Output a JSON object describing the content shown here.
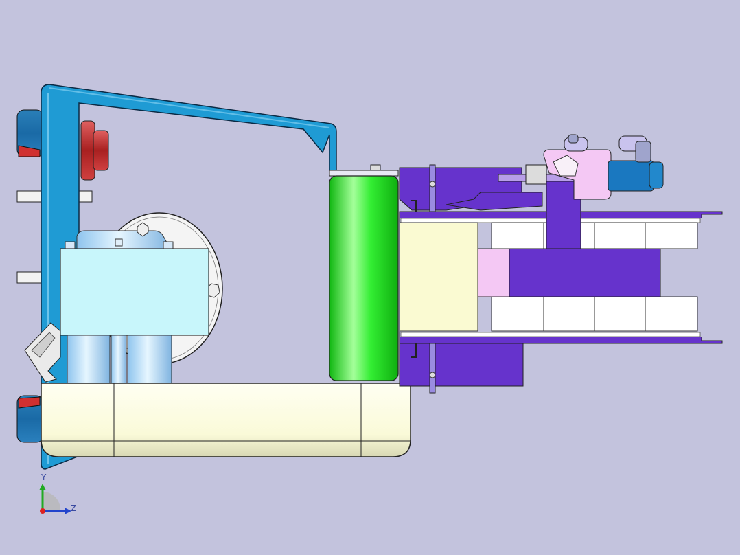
{
  "viewport": {
    "background": "#c3c3dd",
    "axes": {
      "vertical_label": "Y",
      "horizontal_label": "Z"
    }
  },
  "colors": {
    "frame_blue": "#1f9bd4",
    "cylinder_green": "#22e522",
    "purple": "#6633cc",
    "light_yellow": "#fafad2",
    "light_cyan": "#c8f6fb",
    "red": "#cc3333",
    "pink": "#f4c8f4"
  }
}
